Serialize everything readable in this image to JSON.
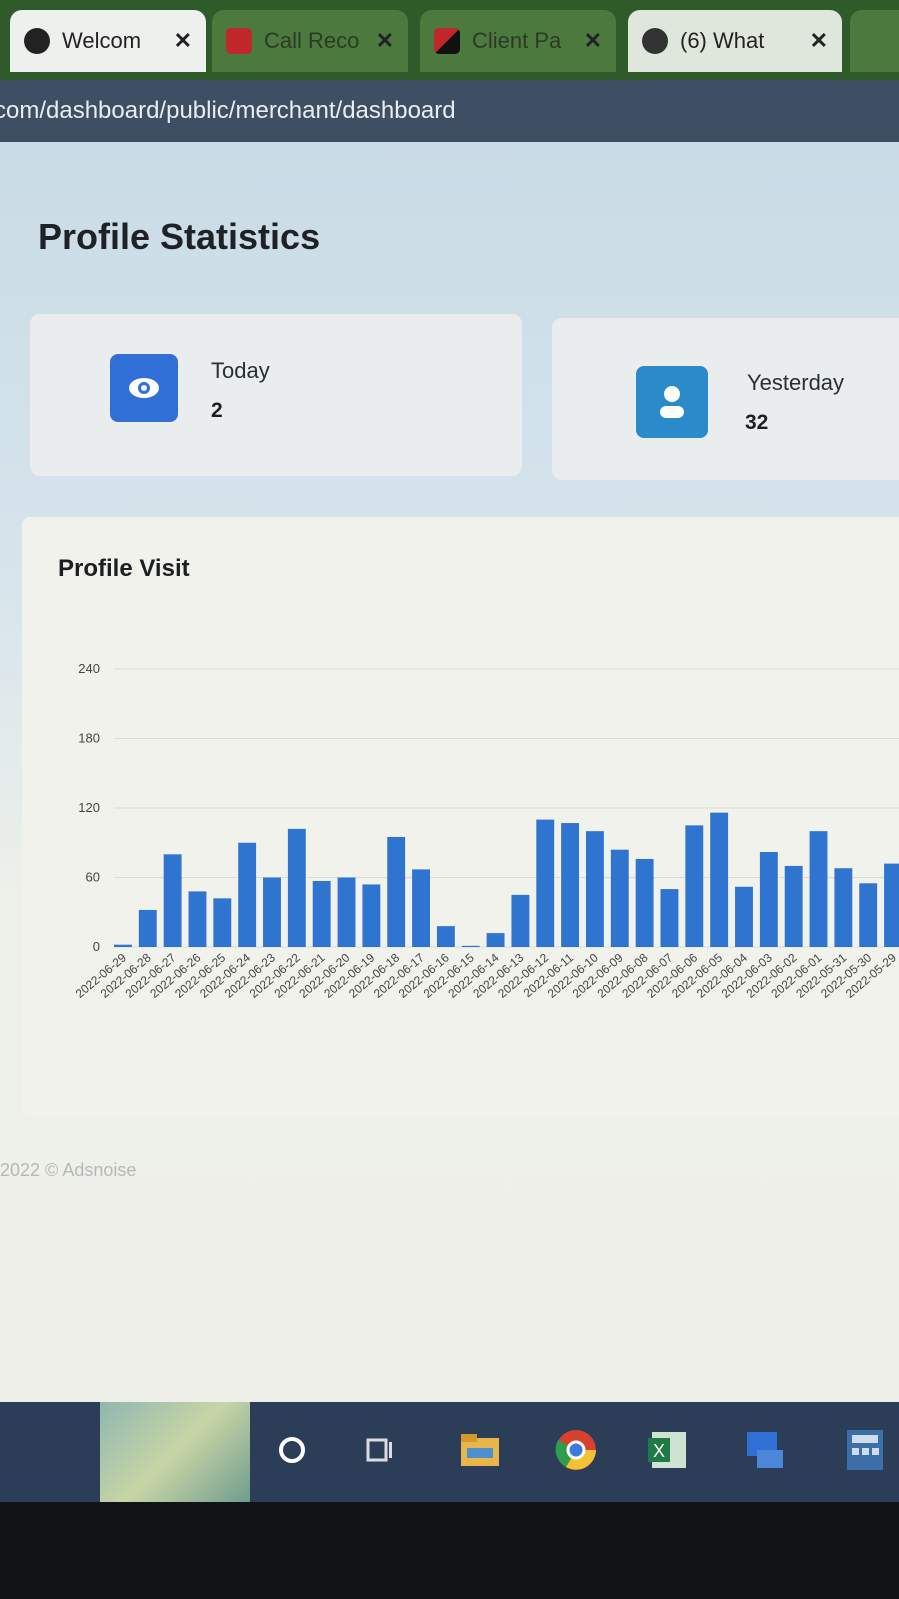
{
  "browser": {
    "tabs": [
      {
        "label": "Welcom",
        "icon": "globe-icon"
      },
      {
        "label": "Call Reco",
        "icon": "call-recorder-icon"
      },
      {
        "label": "Client Pa",
        "icon": "client-portal-icon"
      },
      {
        "label": "(6) What",
        "icon": "whatsapp-icon"
      }
    ],
    "address": "com/dashboard/public/merchant/dashboard"
  },
  "page": {
    "title": "Profile Statistics",
    "stats": [
      {
        "label": "Today",
        "value": "2",
        "icon": "eye-icon",
        "color": "#2f6fd6"
      },
      {
        "label": "Yesterday",
        "value": "32",
        "icon": "user-icon",
        "color": "#2b8ac9"
      }
    ],
    "chart_title": "Profile Visit",
    "footer": "2022 © Adsnoise"
  },
  "chart_data": {
    "type": "bar",
    "title": "Profile Visit",
    "ylim": [
      0,
      240
    ],
    "yticks": [
      0,
      60,
      120,
      180,
      240
    ],
    "bar_color": "#2f74cf",
    "grid": true,
    "categories": [
      "2022-06-29",
      "2022-06-28",
      "2022-06-27",
      "2022-06-26",
      "2022-06-25",
      "2022-06-24",
      "2022-06-23",
      "2022-06-22",
      "2022-06-21",
      "2022-06-20",
      "2022-06-19",
      "2022-06-18",
      "2022-06-17",
      "2022-06-16",
      "2022-06-15",
      "2022-06-14",
      "2022-06-13",
      "2022-06-12",
      "2022-06-11",
      "2022-06-10",
      "2022-06-09",
      "2022-06-08",
      "2022-06-07",
      "2022-06-06",
      "2022-06-05",
      "2022-06-04",
      "2022-06-03",
      "2022-06-02",
      "2022-06-01",
      "2022-05-31",
      "2022-05-30",
      "2022-05-29"
    ],
    "values": [
      2,
      32,
      80,
      48,
      42,
      90,
      60,
      102,
      57,
      60,
      54,
      95,
      67,
      18,
      1,
      12,
      45,
      110,
      107,
      100,
      84,
      76,
      50,
      105,
      116,
      52,
      82,
      70,
      100,
      68,
      55,
      72
    ]
  },
  "taskbar": {
    "items": [
      "search-circle-icon",
      "task-view-icon",
      "file-explorer-icon",
      "chrome-icon",
      "excel-icon",
      "control-panel-icon",
      "calculator-icon"
    ]
  }
}
